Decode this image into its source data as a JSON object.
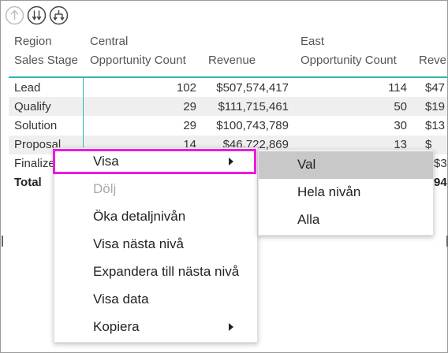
{
  "toolbar": {
    "buttons": [
      "drill-up-icon",
      "drill-down-icon",
      "expand-level-icon"
    ]
  },
  "table": {
    "row_header_1": "Region",
    "row_header_2": "Sales Stage",
    "groups": [
      "Central",
      "East"
    ],
    "columns": [
      "Opportunity Count",
      "Revenue",
      "Opportunity Count",
      "Rever"
    ],
    "rows": [
      {
        "stage": "Lead",
        "c_count": "102",
        "c_rev": "$507,574,417",
        "e_count": "114",
        "e_rev": "$47"
      },
      {
        "stage": "Qualify",
        "c_count": "29",
        "c_rev": "$111,715,461",
        "e_count": "50",
        "e_rev": "$19"
      },
      {
        "stage": "Solution",
        "c_count": "29",
        "c_rev": "$100,743,789",
        "e_count": "30",
        "e_rev": "$13"
      },
      {
        "stage": "Proposal",
        "c_count": "14",
        "c_rev": "$46,722,869",
        "e_count": "13",
        "e_rev": "$"
      },
      {
        "stage": "Finalize",
        "c_count": "",
        "c_rev": "",
        "e_count": "",
        "e_rev": "$3"
      },
      {
        "stage": "Total",
        "c_count": "",
        "c_rev": "",
        "e_count": "",
        "e_rev": "94"
      }
    ]
  },
  "context_menu": {
    "items": [
      "Visa",
      "Dölj",
      "Öka detaljnivån",
      "Visa nästa nivå",
      "Expandera till nästa nivå",
      "Visa data",
      "Kopiera"
    ]
  },
  "submenu": {
    "items": [
      "Val",
      "Hela nivån",
      "Alla"
    ],
    "selected": "Val"
  },
  "colors": {
    "highlight_border": "#ee1ae0",
    "table_rule": "#33b6ad",
    "selected_bg": "#c8c8c8",
    "disabled_text": "#aaaaaa"
  }
}
